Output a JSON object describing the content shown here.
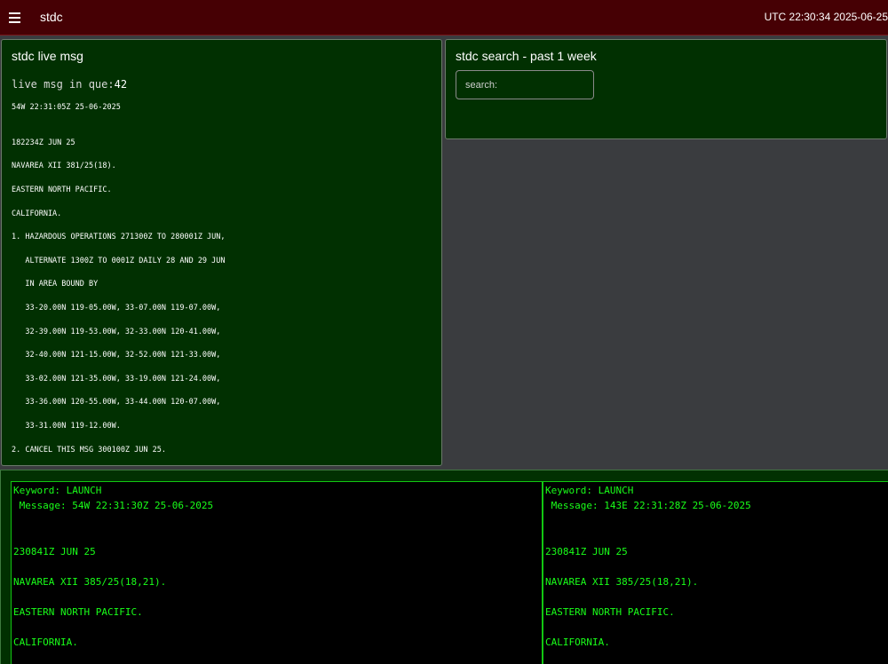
{
  "header": {
    "app_title": "stdc",
    "clock": "UTC 22:30:34 2025-06-25"
  },
  "live_panel": {
    "title": "stdc live msg",
    "queue_label": "live msg in que:",
    "queue_count": "42",
    "message_header": "54W 22:31:05Z 25-06-2025",
    "message_lines": [
      "182234Z JUN 25",
      "NAVAREA XII 381/25(18).",
      "EASTERN NORTH PACIFIC.",
      "CALIFORNIA.",
      "1. HAZARDOUS OPERATIONS 271300Z TO 280001Z JUN,",
      "   ALTERNATE 1300Z TO 0001Z DAILY 28 AND 29 JUN",
      "   IN AREA BOUND BY",
      "   33-20.00N 119-05.00W, 33-07.00N 119-07.00W,",
      "   32-39.00N 119-53.00W, 32-33.00N 120-41.00W,",
      "   32-40.00N 121-15.00W, 32-52.00N 121-33.00W,",
      "   33-02.00N 121-35.00W, 33-19.00N 121-24.00W,",
      "   33-36.00N 120-55.00W, 33-44.00N 120-07.00W,",
      "   33-31.00N 119-12.00W.",
      "2. CANCEL THIS MSG 300100Z JUN 25."
    ]
  },
  "search_panel": {
    "title": "stdc search - past 1 week",
    "placeholder": "search:"
  },
  "results": [
    {
      "keyword": "Keyword: LAUNCH",
      "message": " Message: 54W 22:31:30Z 25-06-2025",
      "lines": [
        "230841Z JUN 25",
        "NAVAREA XII 385/25(18,21).",
        "EASTERN NORTH PACIFIC.",
        "CALIFORNIA."
      ]
    },
    {
      "keyword": "Keyword: LAUNCH",
      "message": " Message: 143E 22:31:28Z 25-06-2025",
      "lines": [
        "230841Z JUN 25",
        "NAVAREA XII 385/25(18,21).",
        "EASTERN NORTH PACIFIC.",
        "CALIFORNIA."
      ]
    }
  ],
  "icons": {
    "menu": "hamburger-menu-icon"
  },
  "colors": {
    "header_bg": "#460004",
    "panel_bg": "#013001",
    "result_text": "#19ff19",
    "result_border": "#12c712",
    "page_bg": "#3a3c3f"
  }
}
